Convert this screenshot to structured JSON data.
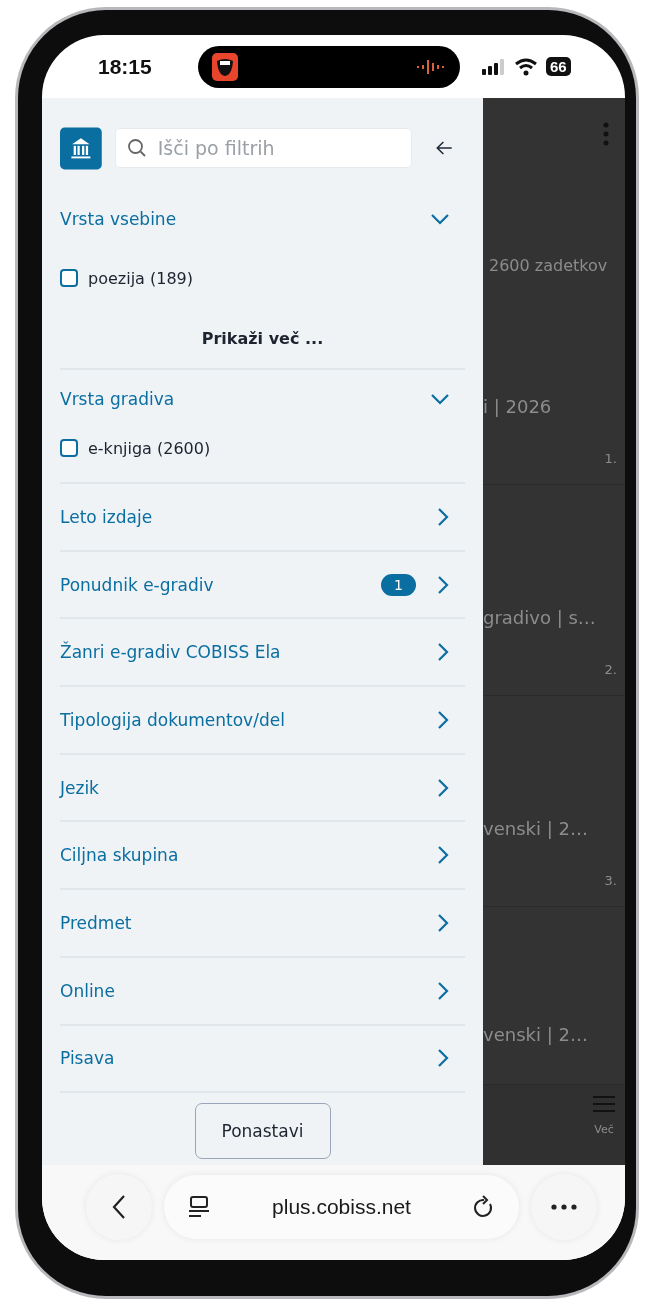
{
  "status_bar": {
    "time": "18:15",
    "battery": "66"
  },
  "drawer": {
    "search": {
      "placeholder": "Išči po filtrih"
    },
    "sections": [
      {
        "kind": "accordion",
        "title": "Vrsta vsebine",
        "expanded": true,
        "options": [
          {
            "label": "poezija (189)",
            "checked": false
          }
        ],
        "show_more": "Prikaži več ..."
      },
      {
        "kind": "accordion",
        "title": "Vrsta gradiva",
        "expanded": true,
        "options": [
          {
            "label": "e-knjiga (2600)",
            "checked": false
          }
        ]
      },
      {
        "kind": "link",
        "title": "Leto izdaje"
      },
      {
        "kind": "link",
        "title": "Ponudnik e-gradiv",
        "badge": "1"
      },
      {
        "kind": "link",
        "title": "Žanri e-gradiv COBISS Ela"
      },
      {
        "kind": "link",
        "title": "Tipologija dokumentov/del"
      },
      {
        "kind": "link",
        "title": "Jezik"
      },
      {
        "kind": "link",
        "title": "Ciljna skupina"
      },
      {
        "kind": "link",
        "title": "Predmet"
      },
      {
        "kind": "link",
        "title": "Online"
      },
      {
        "kind": "link",
        "title": "Pisava"
      }
    ],
    "reset_button": "Ponastavi"
  },
  "background_page": {
    "result_count": "2600 zadetkov",
    "results": [
      {
        "snippet": "i | 2026",
        "number": "1."
      },
      {
        "snippet": "gradivo | s…",
        "number": "2."
      },
      {
        "snippet": "venski | 2…",
        "number": "3."
      },
      {
        "snippet": "venski | 2…"
      }
    ],
    "bottom_nav": {
      "label": "Več"
    }
  },
  "browser": {
    "url": "plus.cobiss.net"
  }
}
